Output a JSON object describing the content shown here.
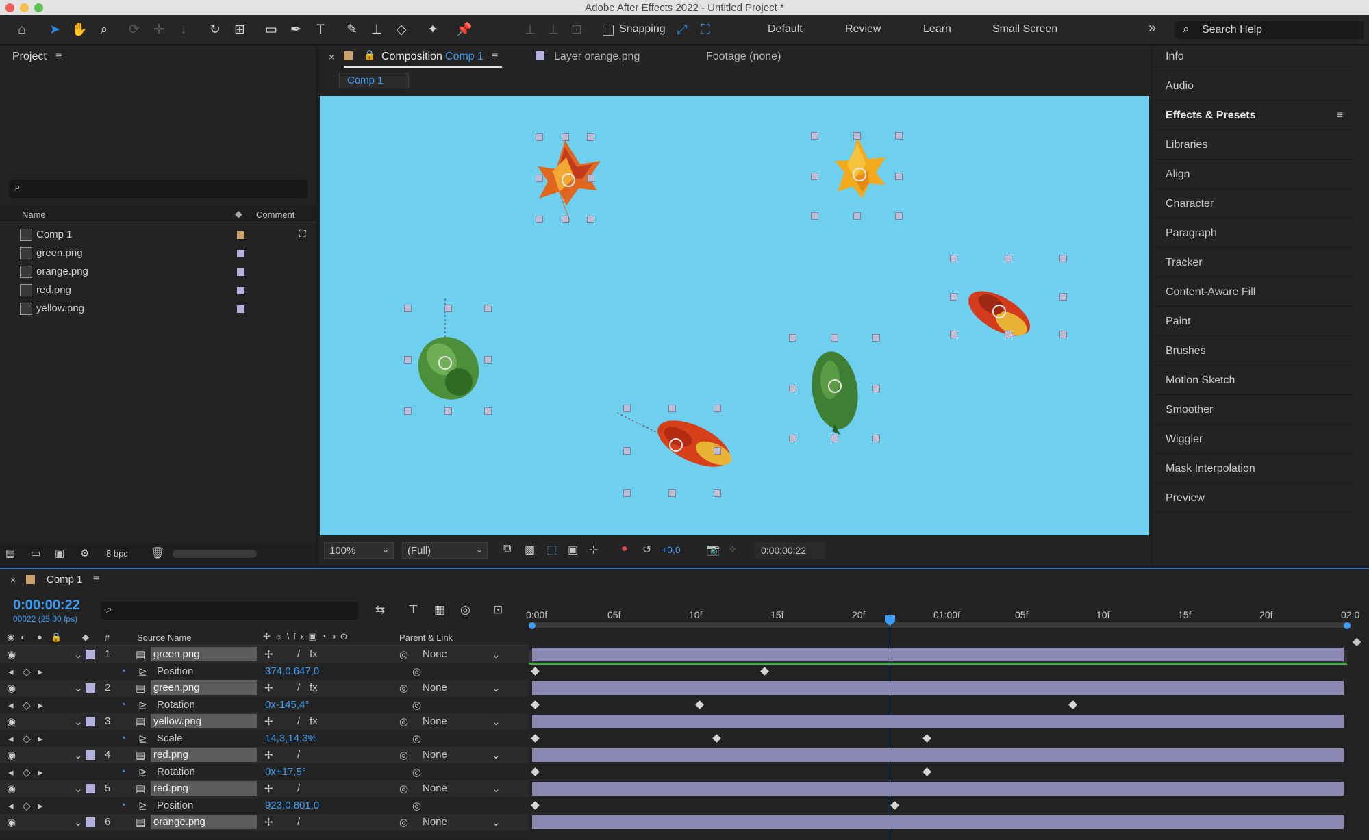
{
  "window": {
    "title": "Adobe After Effects 2022 - Untitled Project *"
  },
  "toolbar": {
    "snapping_label": "Snapping",
    "workspaces": [
      "Default",
      "Review",
      "Learn",
      "Small Screen"
    ],
    "overflow_icon": "double-chevron-right-icon",
    "search_placeholder": "Search Help"
  },
  "project": {
    "title": "Project",
    "col_name": "Name",
    "col_comment": "Comment",
    "items": [
      {
        "name": "Comp 1",
        "type": "composition",
        "color": "#c9a36b"
      },
      {
        "name": "green.png",
        "type": "footage",
        "color": "#b3b0dd"
      },
      {
        "name": "orange.png",
        "type": "footage",
        "color": "#b3b0dd"
      },
      {
        "name": "red.png",
        "type": "footage",
        "color": "#b3b0dd"
      },
      {
        "name": "yellow.png",
        "type": "footage",
        "color": "#b3b0dd"
      }
    ],
    "bpc": "8 bpc"
  },
  "viewer": {
    "tab_composition_prefix": "Composition",
    "tab_composition_name": "Comp 1",
    "tab_layer": "Layer orange.png",
    "tab_footage": "Footage (none)",
    "breadcrumb": "Comp 1",
    "zoom": "100%",
    "resolution": "(Full)",
    "exposure": "+0,0",
    "timecode": "0:00:00:22",
    "bg_color": "#6fcfee"
  },
  "right_panel": {
    "items": [
      "Info",
      "Audio",
      "Effects & Presets",
      "Libraries",
      "Align",
      "Character",
      "Paragraph",
      "Tracker",
      "Content-Aware Fill",
      "Paint",
      "Brushes",
      "Motion Sketch",
      "Smoother",
      "Wiggler",
      "Mask Interpolation",
      "Preview"
    ],
    "active": "Effects & Presets"
  },
  "timeline": {
    "tab": "Comp 1",
    "timecode": "0:00:00:22",
    "frame_info": "00022 (25.00 fps)",
    "col_source": "Source Name",
    "col_parent": "Parent & Link",
    "col_hash": "#",
    "ruler_labels": [
      "0:00f",
      "05f",
      "10f",
      "15f",
      "20f",
      "01:00f",
      "05f",
      "10f",
      "15f",
      "20f",
      "02:0"
    ],
    "rows": [
      {
        "kind": "layer",
        "num": "1",
        "name": "green.png",
        "parent": "None",
        "fx": true
      },
      {
        "kind": "prop",
        "name": "Position",
        "value": "374,0,647,0"
      },
      {
        "kind": "layer",
        "num": "2",
        "name": "green.png",
        "parent": "None",
        "fx": true
      },
      {
        "kind": "prop",
        "name": "Rotation",
        "value": "0x-145,4°"
      },
      {
        "kind": "layer",
        "num": "3",
        "name": "yellow.png",
        "parent": "None",
        "fx": true
      },
      {
        "kind": "prop",
        "name": "Scale",
        "value": "14,3,14,3%"
      },
      {
        "kind": "layer",
        "num": "4",
        "name": "red.png",
        "parent": "None",
        "fx": false
      },
      {
        "kind": "prop",
        "name": "Rotation",
        "value": "0x+17,5°"
      },
      {
        "kind": "layer",
        "num": "5",
        "name": "red.png",
        "parent": "None",
        "fx": false
      },
      {
        "kind": "prop",
        "name": "Position",
        "value": "923,0,801,0"
      },
      {
        "kind": "layer",
        "num": "6",
        "name": "orange.png",
        "parent": "None",
        "fx": false
      }
    ]
  }
}
